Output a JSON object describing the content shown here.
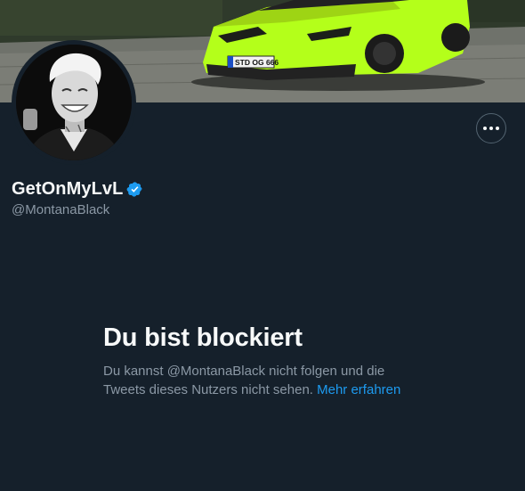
{
  "profile": {
    "display_name": "GetOnMyLvL",
    "handle": "@MontanaBlack",
    "verified_icon": "verified-badge-icon",
    "banner_plate": "STD OG 666"
  },
  "actions": {
    "more_icon": "more-horizontal-icon"
  },
  "blocked": {
    "title": "Du bist blockiert",
    "description": "Du kannst @MontanaBlack nicht folgen und die Tweets dieses Nutzers nicht sehen.",
    "link_label": "Mehr erfahren"
  },
  "colors": {
    "background": "#15202b",
    "accent": "#1d9bf0",
    "secondary_text": "#8b98a5",
    "car": "#b4ff1a"
  }
}
